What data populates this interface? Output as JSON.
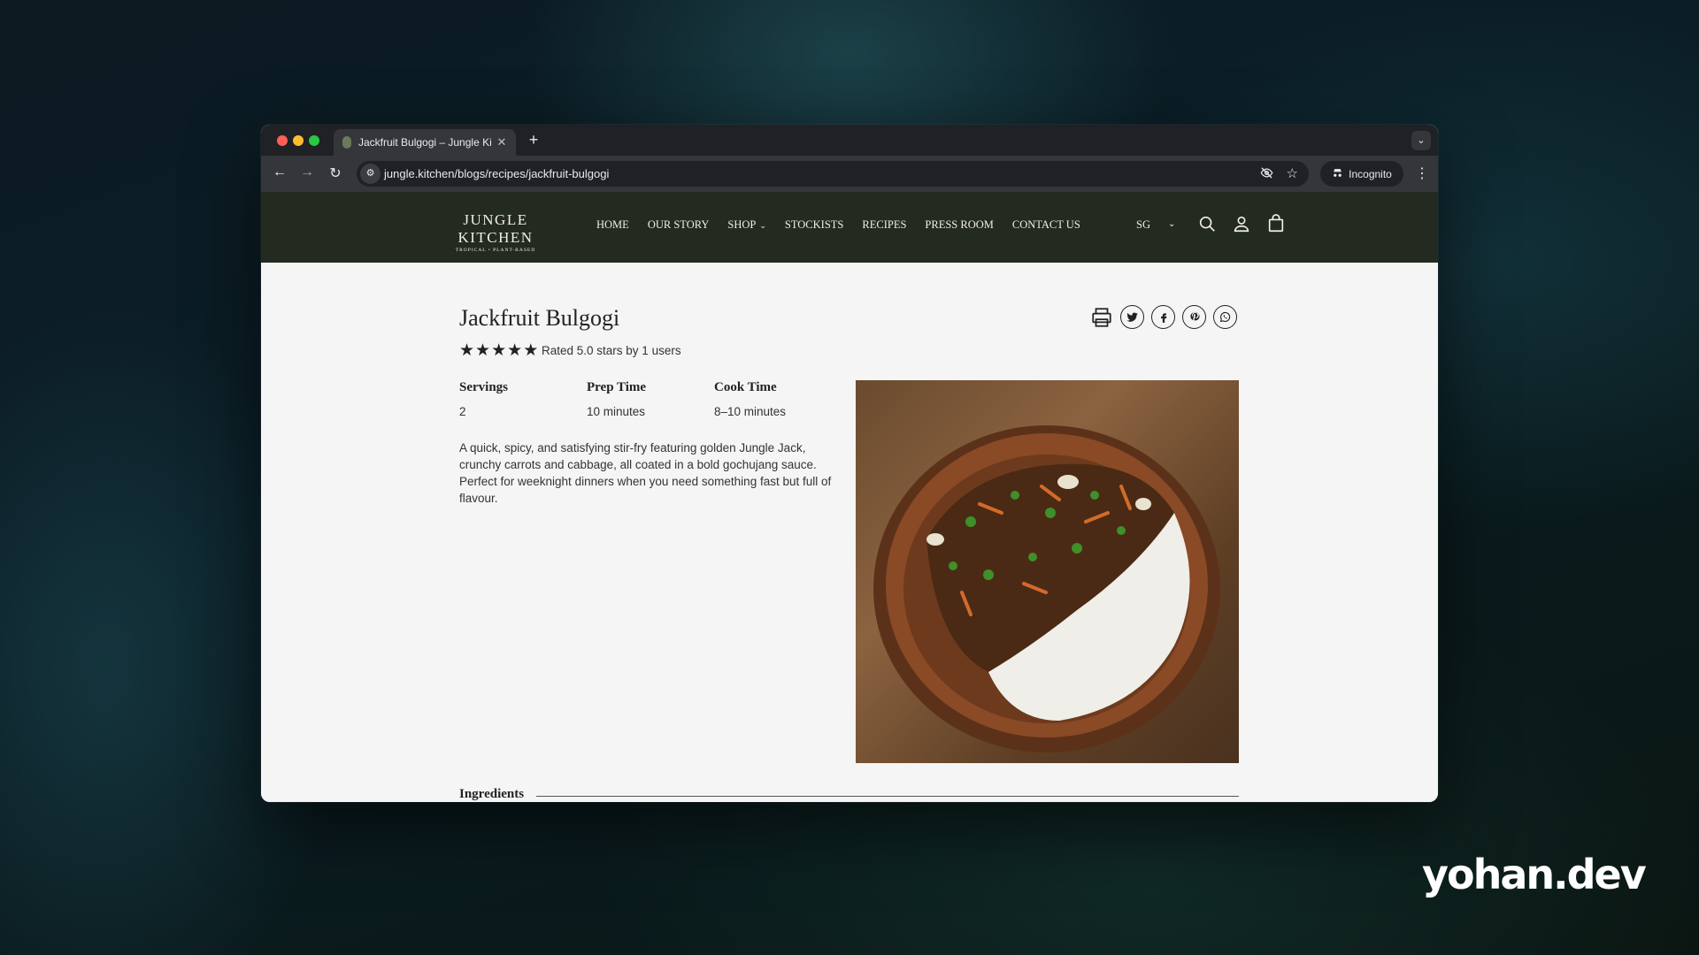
{
  "browser": {
    "tab_title": "Jackfruit Bulgogi – Jungle Ki",
    "url": "jungle.kitchen/blogs/recipes/jackfruit-bulgogi",
    "incognito_label": "Incognito"
  },
  "site": {
    "logo": {
      "name": "JUNGLE KITCHEN",
      "tagline": "TROPICAL • PLANT-BASED"
    },
    "nav": [
      {
        "label": "HOME"
      },
      {
        "label": "OUR STORY"
      },
      {
        "label": "SHOP",
        "has_dropdown": true
      },
      {
        "label": "STOCKISTS"
      },
      {
        "label": "RECIPES"
      },
      {
        "label": "PRESS ROOM"
      },
      {
        "label": "CONTACT US"
      }
    ],
    "region": "SG",
    "header_icons": [
      "search-icon",
      "account-icon",
      "cart-icon"
    ],
    "colors": {
      "header_bg": "#232a1f",
      "page_bg": "#f4f5f4",
      "text": "#222222"
    }
  },
  "recipe": {
    "title": "Jackfruit Bulgogi",
    "rating": 5.0,
    "star_count": 5,
    "rating_text": "Rated 5.0 stars by 1 users",
    "share_icons": [
      "print-icon",
      "twitter-icon",
      "facebook-icon",
      "pinterest-icon",
      "whatsapp-icon"
    ],
    "meta": {
      "servings_label": "Servings",
      "servings_value": "2",
      "prep_label": "Prep Time",
      "prep_value": "10 minutes",
      "cook_label": "Cook Time",
      "cook_value": "8–10 minutes"
    },
    "description": "A quick, spicy, and satisfying stir-fry featuring golden Jungle Jack, crunchy carrots and cabbage, all coated in a bold gochujang sauce. Perfect for weeknight dinners when you need something fast but full of flavour.",
    "ingredients_heading": "Ingredients"
  },
  "watermark": "yohan.dev"
}
